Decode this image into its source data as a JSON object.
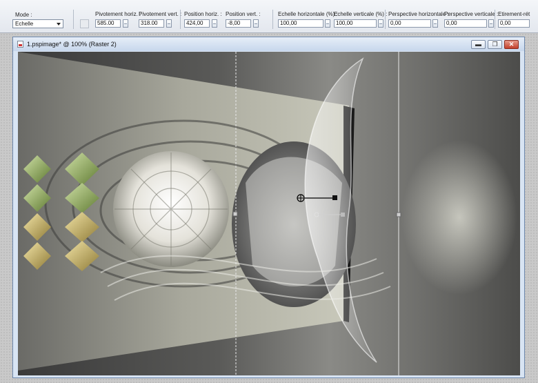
{
  "toolbar": {
    "mode": {
      "label": "Mode :",
      "value": "Echelle"
    },
    "fields": [
      {
        "label": "Pivotement horiz. :",
        "value": "585.00"
      },
      {
        "label": "Pivotement vert. :",
        "value": "318.00"
      },
      {
        "label": "Position horiz. :",
        "value": "424,00"
      },
      {
        "label": "Position vert. :",
        "value": "-8,00"
      },
      {
        "label": "Echelle horizontale (%) :",
        "value": "100,00"
      },
      {
        "label": "Echelle verticale (%) :",
        "value": "100,00"
      },
      {
        "label": "Perspective horizontale :",
        "value": "0,00"
      },
      {
        "label": "Perspective verticale :",
        "value": "0,00"
      },
      {
        "label": "Etirement-rét",
        "value": "0,00"
      }
    ]
  },
  "window": {
    "title": "1.pspimage* @ 100% (Raster 2)",
    "minimize_glyph": "▬",
    "maximize_glyph": "❐",
    "close_glyph": "✕"
  },
  "icons": {
    "document": "document-icon",
    "minimize": "minimize-icon",
    "maximize": "maximize-icon",
    "close": "close-icon"
  },
  "colors": {
    "window_border": "#6d88ad",
    "title_gradient_top": "#e6eef8",
    "close_red": "#c2402c"
  }
}
